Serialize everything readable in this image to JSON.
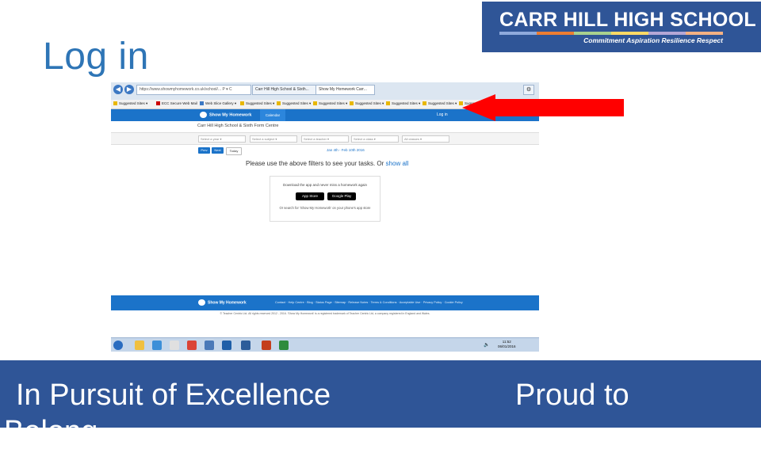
{
  "slide": {
    "title": "Log in",
    "footer_left": "In Pursuit of Excellence",
    "footer_right": "Proud to",
    "footer_wrap": "Belong"
  },
  "logo": {
    "name": "CARR HILL HIGH SCHOOL",
    "tagline": "Commitment  Aspiration  Resilience  Respect",
    "stripe_colors": [
      "#8faadc",
      "#ed7d31",
      "#a9d18e",
      "#ffd966",
      "#b4a7d6",
      "#f4b183"
    ]
  },
  "browser": {
    "address": "https://www.showmyhomework.co.uk/school/...  P ▾ C",
    "tabs": [
      "Carr Hill High School & Sixth...",
      "Show My Homework Carr..."
    ],
    "favorites": [
      "Suggested Sites ▾",
      "ECC Secure Web Mail",
      "Web Slice Gallery ▾",
      "Suggested Sites ▾",
      "Suggested Sites ▾",
      "Suggested Sites ▾",
      "Suggested Sites ▾",
      "Suggested Sites ▾",
      "Suggested Sites ▾",
      "Suggested Sites ▾"
    ]
  },
  "site": {
    "brand": "Show My Homework",
    "calendar_tab": "Calendar",
    "login_link": "Log in",
    "school_name": "Carr Hill High School & Sixth Form Centre",
    "filters": [
      "Select a year ▾",
      "Select a subject ▾",
      "Select a teacher ▾",
      "Select a class ▾",
      "All classes ▾"
    ],
    "buttons": {
      "prev": "Prev",
      "next": "Next",
      "today": "Today"
    },
    "date_range": "Jan 4th - Feb 10th 2016",
    "message": "Please use the above filters to see your tasks. Or",
    "message_link": "show all",
    "app_prompt": "Download the app and never miss a homework again",
    "app_store": "App Store",
    "google_play": "Google Play",
    "app_note": "Or search for 'Show My Homework' on your phone's app store",
    "footer_links": "Contact · Help Centre · Blog · Status Page · Sitemap · Release Notes · Terms & Conditions · Acceptable Use · Privacy Policy · Cookie Policy",
    "footer_legal": "© Teacher Centric Ltd. All rights reserved 2012 - 2016. 'Show My Homework' is a registered trademark of Teacher Centric Ltd, a company registered in England and Wales."
  },
  "taskbar": {
    "time": "11:52",
    "date": "06/01/2016"
  }
}
